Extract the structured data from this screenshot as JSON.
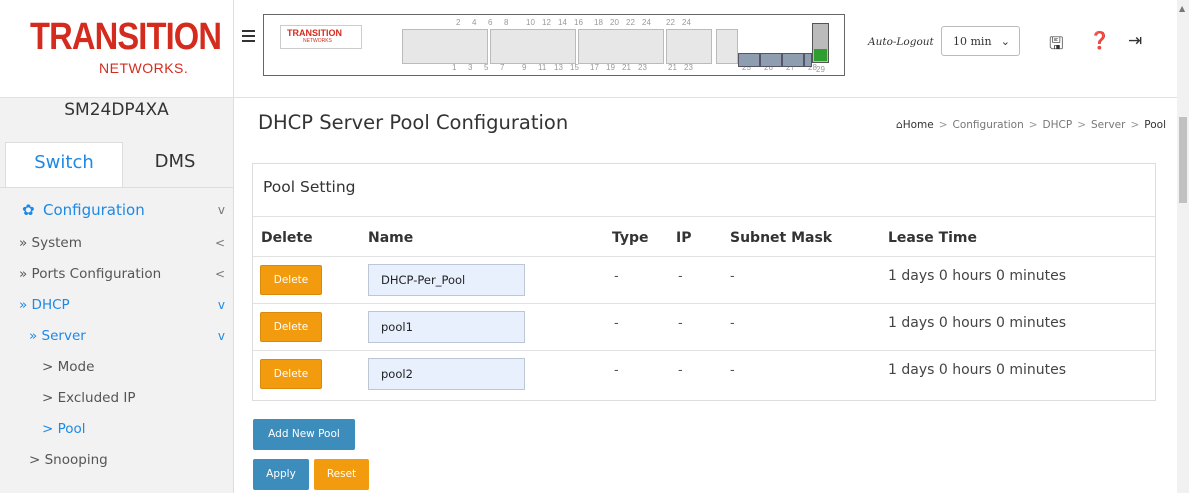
{
  "brand": {
    "logo_main": "TRANSITION",
    "logo_sub": "NETWORKS.",
    "panel_logo_main": "TRANSITION",
    "panel_logo_sub": "NETWORKS"
  },
  "device": {
    "model": "SM24DP4XA"
  },
  "sidebar": {
    "tabs": [
      {
        "label": "Switch"
      },
      {
        "label": "DMS"
      }
    ],
    "items": [
      {
        "label": "Configuration",
        "chevron": "v"
      },
      {
        "label": "» System",
        "chevron": "<"
      },
      {
        "label": "» Ports Configuration",
        "chevron": "<"
      },
      {
        "label": "» DHCP",
        "chevron": "v"
      },
      {
        "label": "» Server",
        "chevron": "v"
      },
      {
        "label": "> Mode"
      },
      {
        "label": "> Excluded IP"
      },
      {
        "label": "> Pool"
      },
      {
        "label": "> Snooping"
      }
    ]
  },
  "panel": {
    "top_ports": [
      "2",
      "4",
      "6",
      "8",
      "10",
      "12",
      "14",
      "16",
      "18",
      "20",
      "22",
      "24",
      "22",
      "24"
    ],
    "bottom_ports": [
      "1",
      "3",
      "5",
      "7",
      "9",
      "11",
      "13",
      "15",
      "17",
      "19",
      "21",
      "23",
      "21",
      "23",
      "25",
      "26",
      "27",
      "28",
      "29"
    ]
  },
  "header": {
    "auto_logout_label": "Auto-Logout",
    "auto_logout_value": "10 min",
    "icons": [
      "save-icon",
      "help-icon",
      "logout-icon"
    ]
  },
  "page": {
    "title": "DHCP Server Pool Configuration",
    "breadcrumb": [
      "Home",
      "Configuration",
      "DHCP",
      "Server",
      "Pool"
    ]
  },
  "pool_setting": {
    "heading": "Pool Setting",
    "columns": [
      "Delete",
      "Name",
      "Type",
      "IP",
      "Subnet Mask",
      "Lease Time"
    ],
    "rows": [
      {
        "delete_label": "Delete",
        "name": "DHCP-Per_Pool",
        "type": "-",
        "ip": "-",
        "subnet": "-",
        "lease": "1 days 0 hours 0 minutes"
      },
      {
        "delete_label": "Delete",
        "name": "pool1",
        "type": "-",
        "ip": "-",
        "subnet": "-",
        "lease": "1 days 0 hours 0 minutes"
      },
      {
        "delete_label": "Delete",
        "name": "pool2",
        "type": "-",
        "ip": "-",
        "subnet": "-",
        "lease": "1 days 0 hours 0 minutes"
      }
    ]
  },
  "actions": {
    "add_new_pool": "Add New Pool",
    "apply": "Apply",
    "reset": "Reset"
  },
  "colors": {
    "accent": "#1e88e5",
    "delete_button": "#f29b0f",
    "primary_button": "#3c8dbc",
    "logo_red": "#d52b1e"
  }
}
